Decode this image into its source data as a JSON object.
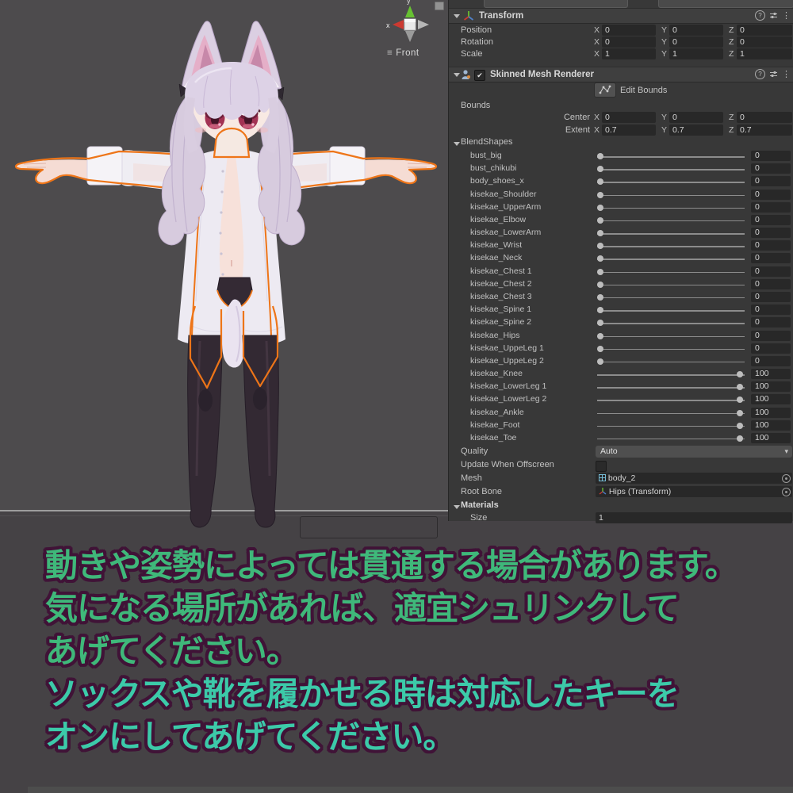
{
  "axes": [
    "X",
    "Y",
    "Z"
  ],
  "icons": {
    "help": "?",
    "kebab": "⋮",
    "hamburger": "≡",
    "check": "✔",
    "dropdown_arrow": "▾"
  },
  "scene": {
    "gizmo": {
      "front_label": "Front",
      "x_axis_label": "x",
      "y_axis_label": "y"
    }
  },
  "inspector": {
    "transform": {
      "title": "Transform",
      "rows": [
        {
          "label": "Position",
          "values": [
            "0",
            "0",
            "0"
          ]
        },
        {
          "label": "Rotation",
          "values": [
            "0",
            "0",
            "0"
          ]
        },
        {
          "label": "Scale",
          "values": [
            "1",
            "1",
            "1"
          ]
        }
      ]
    },
    "smr": {
      "title": "Skinned Mesh Renderer",
      "edit_bounds_label": "Edit Bounds",
      "bounds_label": "Bounds",
      "center": {
        "label": "Center",
        "values": [
          "0",
          "0",
          "0"
        ]
      },
      "extent": {
        "label": "Extent",
        "values": [
          "0.7",
          "0.7",
          "0.7"
        ]
      },
      "blendshapes_label": "BlendShapes",
      "blendshapes": [
        {
          "name": "bust_big",
          "value": 0
        },
        {
          "name": "bust_chikubi",
          "value": 0
        },
        {
          "name": "body_shoes_x",
          "value": 0
        },
        {
          "name": "kisekae_Shoulder",
          "value": 0
        },
        {
          "name": "kisekae_UpperArm",
          "value": 0
        },
        {
          "name": "kisekae_Elbow",
          "value": 0
        },
        {
          "name": "kisekae_LowerArm",
          "value": 0
        },
        {
          "name": "kisekae_Wrist",
          "value": 0
        },
        {
          "name": "kisekae_Neck",
          "value": 0
        },
        {
          "name": "kisekae_Chest 1",
          "value": 0
        },
        {
          "name": "kisekae_Chest 2",
          "value": 0
        },
        {
          "name": "kisekae_Chest 3",
          "value": 0
        },
        {
          "name": "kisekae_Spine 1",
          "value": 0
        },
        {
          "name": "kisekae_Spine 2",
          "value": 0
        },
        {
          "name": "kisekae_Hips",
          "value": 0
        },
        {
          "name": "kisekae_UppeLeg 1",
          "value": 0
        },
        {
          "name": "kisekae_UppeLeg 2",
          "value": 0
        },
        {
          "name": "kisekae_Knee",
          "value": 100
        },
        {
          "name": "kisekae_LowerLeg 1",
          "value": 100
        },
        {
          "name": "kisekae_LowerLeg 2",
          "value": 100
        },
        {
          "name": "kisekae_Ankle",
          "value": 100
        },
        {
          "name": "kisekae_Foot",
          "value": 100
        },
        {
          "name": "kisekae_Toe",
          "value": 100
        }
      ],
      "quality_label": "Quality",
      "quality_value": "Auto",
      "offscreen_label": "Update When Offscreen",
      "mesh_label": "Mesh",
      "mesh_value": "body_2",
      "root_bone_label": "Root Bone",
      "root_bone_value": "Hips (Transform)",
      "materials_label": "Materials",
      "size_label": "Size",
      "size_value": "1"
    }
  },
  "caption": {
    "lines": [
      {
        "text": "動きや姿勢によっては貫通する場合があります。",
        "color": "#3fb87a"
      },
      {
        "text": "気になる場所があれば、適宜シュリンクして",
        "color": "#3fb87a"
      },
      {
        "text": "あげてください。",
        "color": "#3fb87a"
      },
      {
        "text": "ソックスや靴を履かせる時は対応したキーを",
        "color": "#3ccaa9"
      },
      {
        "text": "オンにしてあげてください。",
        "color": "#3ccaa9"
      }
    ]
  },
  "colors": {
    "selection_outline": "#ee7518",
    "caption_outline": "#401337",
    "viewport_bg": "#4d4b4d"
  }
}
